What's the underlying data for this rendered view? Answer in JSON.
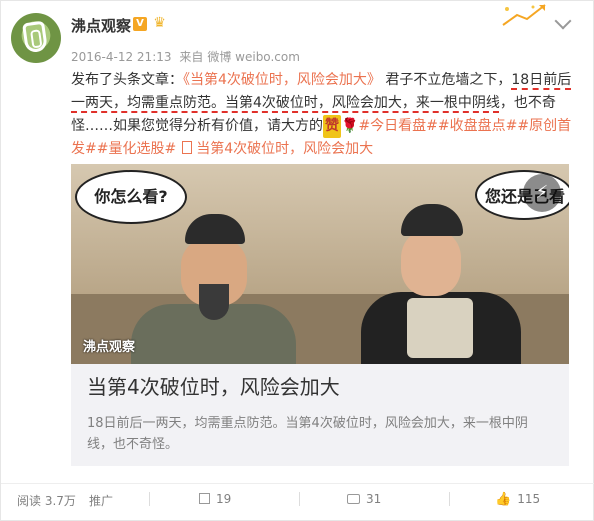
{
  "post": {
    "author": "沸点观察",
    "v_badge": "V",
    "vip_badge": "♛",
    "timestamp": "2016-4-12 21:13",
    "source_prefix": "来自",
    "source": "微博 weibo.com",
    "text_parts": {
      "p1": "发布了头条文章：",
      "p2": "《当第4次破位时，风险会加大》",
      "p3": " 君子不立危墙之下，",
      "p4": "18日前后一两天，均需重点防范。当第4次破位时，风险会加大，来一根中阴线",
      "p5": "，也不奇怪……如果您觉得分析有价值，请大方的",
      "zan": "赞",
      "rose": "🌹",
      "tags": "#今日看盘##收盘盘点##原创首发##量化选股#",
      "article_link": "当第4次破位时，风险会加大"
    }
  },
  "thumbnail": {
    "bubble_left": "你怎么看?",
    "bubble_right": "您还是己看",
    "watermark": "沸点观察",
    "flash_icon": "⚡"
  },
  "article": {
    "title": "当第4次破位时，风险会加大",
    "summary": "18日前后一两天，均需重点防范。当第4次破位时，风险会加大，来一根中阴线，也不奇怪。"
  },
  "footer": {
    "views": "阅读 3.7万",
    "promote": "推广",
    "shares": "19",
    "comments": "31",
    "likes": "115",
    "like_icon": "👍"
  },
  "colors": {
    "link": "#eb7350",
    "highlight_underline": "#e0302a"
  }
}
